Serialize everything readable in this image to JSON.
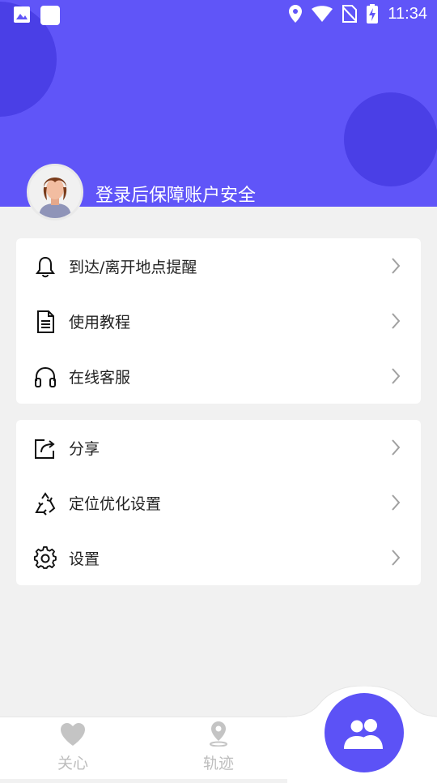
{
  "status_bar": {
    "time": "11:34",
    "left_icons": [
      "image-icon",
      "square-icon"
    ],
    "right_icons": [
      "location-pin-icon",
      "wifi-icon",
      "no-sim-icon",
      "battery-charging-icon"
    ]
  },
  "header": {
    "background_color": "#6055f8",
    "accent_circle_color": "#4a3fe6"
  },
  "profile": {
    "avatar_icon": "user-avatar",
    "login_prompt": "登录后保障账户安全"
  },
  "menu_group_1": [
    {
      "icon": "bell-icon",
      "label": "到达/离开地点提醒"
    },
    {
      "icon": "document-icon",
      "label": "使用教程"
    },
    {
      "icon": "headphones-icon",
      "label": "在线客服"
    }
  ],
  "menu_group_2": [
    {
      "icon": "share-icon",
      "label": "分享"
    },
    {
      "icon": "recycle-icon",
      "label": "定位优化设置"
    },
    {
      "icon": "gear-icon",
      "label": "设置"
    }
  ],
  "bottom_nav": {
    "items": [
      {
        "icon": "heart-icon",
        "label": "关心"
      },
      {
        "icon": "location-icon",
        "label": "轨迹"
      }
    ],
    "fab_icon": "people-icon",
    "fab_color": "#5c52f6"
  }
}
